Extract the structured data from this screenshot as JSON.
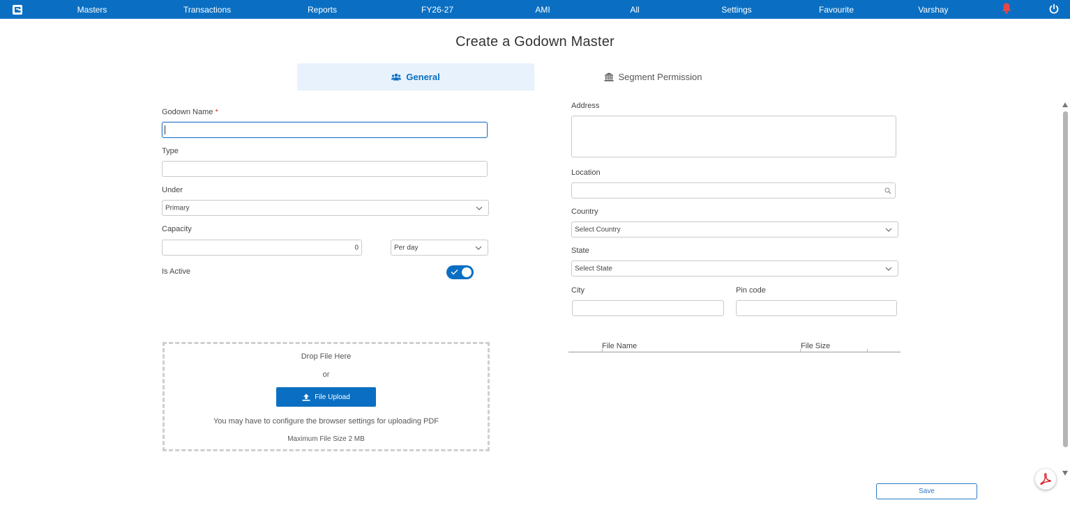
{
  "topbar": {
    "nav": [
      "Masters",
      "Transactions",
      "Reports",
      "FY26-27",
      "AMI",
      "All",
      "Settings",
      "Favourite",
      "Varshay"
    ],
    "bg_color": "#0a6fc2",
    "icons": {
      "logo": "app-logo-icon",
      "bell": "bell-icon",
      "power": "power-icon"
    },
    "bell_color": "#e8474a"
  },
  "page": {
    "title": "Create a Godown Master"
  },
  "tabs": {
    "general": "General",
    "segment": "Segment Permission"
  },
  "left": {
    "godown_name": {
      "label": "Godown Name",
      "required": "*",
      "value": ""
    },
    "type": {
      "label": "Type",
      "value": ""
    },
    "under": {
      "label": "Under",
      "value": "Primary"
    },
    "capacity": {
      "label": "Capacity",
      "value": "0",
      "unit": "Per day"
    },
    "is_active": {
      "label": "Is Active",
      "checked": true
    }
  },
  "right": {
    "address": {
      "label": "Address",
      "value": ""
    },
    "location": {
      "label": "Location",
      "value": ""
    },
    "country": {
      "label": "Country",
      "placeholder": "Select Country"
    },
    "state": {
      "label": "State",
      "placeholder": "Select State"
    },
    "city": {
      "label": "City",
      "value": ""
    },
    "pincode": {
      "label": "Pin code",
      "value": ""
    }
  },
  "upload": {
    "drop_text": "Drop File Here",
    "or_text": "or",
    "button": "File Upload",
    "note": "You may have to configure the browser settings for uploading PDF",
    "max_size": "Maximum File Size 2 MB"
  },
  "files_table": {
    "columns": [
      "File Name",
      "File Size"
    ]
  },
  "actions": {
    "save": "Save"
  }
}
